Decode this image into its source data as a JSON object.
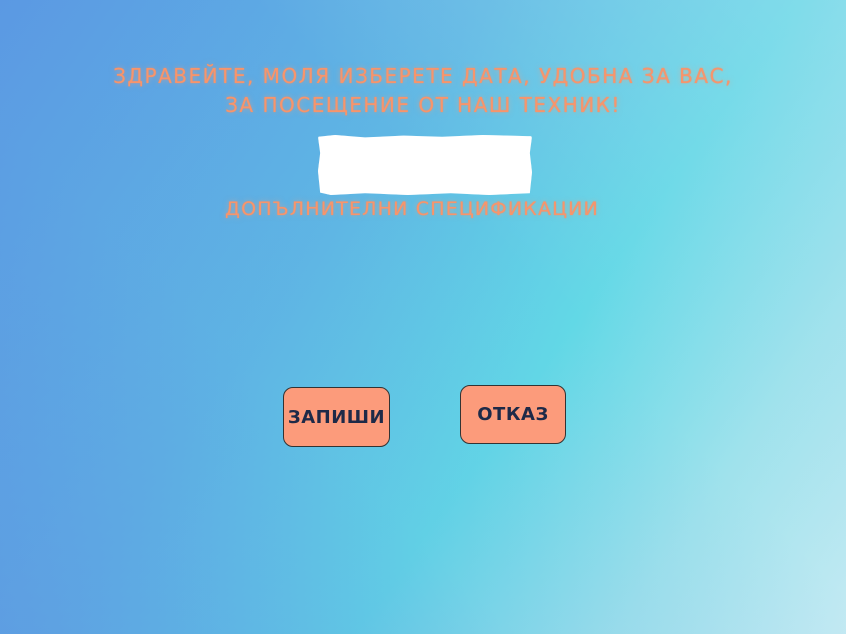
{
  "heading": {
    "line1": "ЗДРАВЕЙТЕ, МОЛЯ ИЗБЕРЕТЕ ДАТА, УДОБНА ЗА ВАС,",
    "line2": "ЗА ПОСЕЩЕНИЕ ОТ НАШ ТЕХНИК!"
  },
  "date_input": {
    "value": "",
    "placeholder": ""
  },
  "specifications_label": "ДОПЪЛНИТЕЛНИ СПЕЦИФИКАЦИИ",
  "buttons": {
    "save_label": "ЗАПИШИ",
    "cancel_label": "ОТКАЗ"
  },
  "colors": {
    "accent_text": "#f7956c",
    "button_fill": "#fc9b7b",
    "button_text": "#1e2a48",
    "background_start": "#5b98e3",
    "background_end": "#c4eaf3"
  }
}
